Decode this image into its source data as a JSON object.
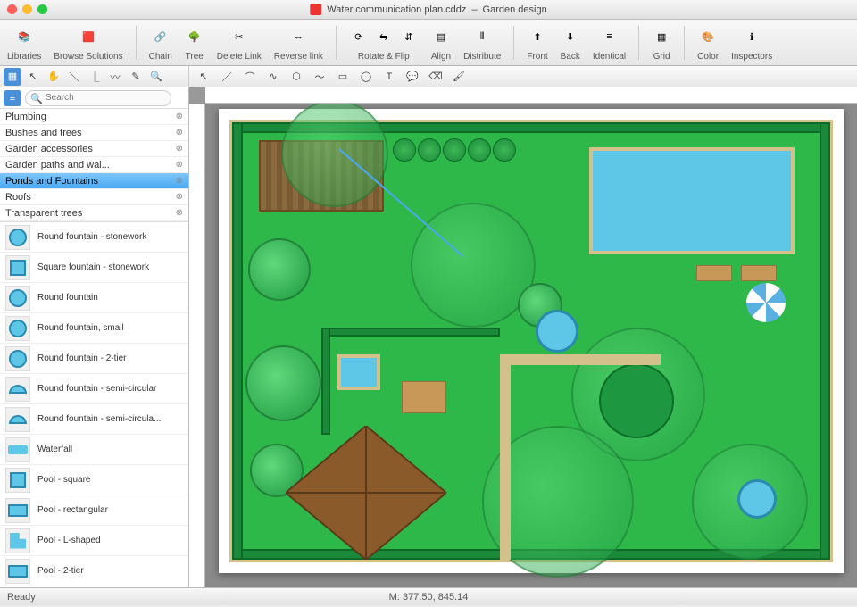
{
  "window": {
    "title_doc": "Water communication plan.cddz",
    "title_app": "Garden design"
  },
  "toolbar": {
    "groups": [
      {
        "label": "Libraries",
        "names": [
          "libraries-icon"
        ]
      },
      {
        "label": "Browse Solutions",
        "names": [
          "solutions-icon"
        ]
      },
      {
        "label": "Chain",
        "names": [
          "chain-icon"
        ]
      },
      {
        "label": "Tree",
        "names": [
          "tree-icon"
        ]
      },
      {
        "label": "Delete Link",
        "names": [
          "delete-link-icon"
        ]
      },
      {
        "label": "Reverse link",
        "names": [
          "reverse-link-icon"
        ]
      },
      {
        "label": "Rotate & Flip",
        "names": [
          "rotate-icon",
          "flip-h-icon",
          "flip-v-icon"
        ]
      },
      {
        "label": "Align",
        "names": [
          "align-icon"
        ]
      },
      {
        "label": "Distribute",
        "names": [
          "distribute-icon"
        ]
      },
      {
        "label": "Front",
        "names": [
          "front-icon"
        ]
      },
      {
        "label": "Back",
        "names": [
          "back-icon"
        ]
      },
      {
        "label": "Identical",
        "names": [
          "identical-icon"
        ]
      },
      {
        "label": "Grid",
        "names": [
          "grid-icon"
        ]
      },
      {
        "label": "Color",
        "names": [
          "color-icon"
        ]
      },
      {
        "label": "Inspectors",
        "names": [
          "inspectors-icon"
        ]
      }
    ]
  },
  "sidebar": {
    "search_placeholder": "Search",
    "categories": [
      {
        "label": "Plumbing",
        "selected": false
      },
      {
        "label": "Bushes and trees",
        "selected": false
      },
      {
        "label": "Garden accessories",
        "selected": false
      },
      {
        "label": "Garden paths and wal...",
        "selected": false
      },
      {
        "label": "Ponds and Fountains",
        "selected": true
      },
      {
        "label": "Roofs",
        "selected": false
      },
      {
        "label": "Transparent trees",
        "selected": false
      }
    ],
    "shapes": [
      {
        "label": "Round fountain - stonework",
        "thumb": "circ"
      },
      {
        "label": "Square fountain - stonework",
        "thumb": "sq"
      },
      {
        "label": "Round fountain",
        "thumb": "circ"
      },
      {
        "label": "Round fountain, small",
        "thumb": "circ"
      },
      {
        "label": "Round fountain - 2-tier",
        "thumb": "circ"
      },
      {
        "label": "Round fountain - semi-circular",
        "thumb": "semi"
      },
      {
        "label": "Round fountain - semi-circula...",
        "thumb": "semi"
      },
      {
        "label": "Waterfall",
        "thumb": "wave"
      },
      {
        "label": "Pool - square",
        "thumb": "sq"
      },
      {
        "label": "Pool - rectangular",
        "thumb": "rect"
      },
      {
        "label": "Pool - L-shaped",
        "thumb": "l"
      },
      {
        "label": "Pool - 2-tier",
        "thumb": "rect"
      }
    ]
  },
  "status": {
    "ready": "Ready",
    "coords_label": "M:",
    "coords_value": "377.50, 845.14"
  }
}
